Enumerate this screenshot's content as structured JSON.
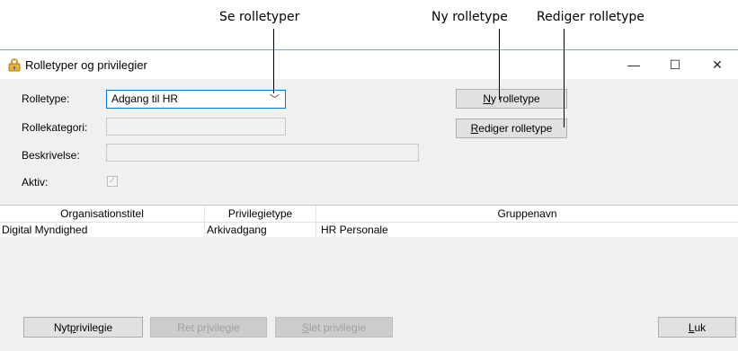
{
  "callouts": {
    "see_role_types": "Se rolletyper",
    "new_role_type": "Ny rolletype",
    "edit_role_type": "Rediger rolletype"
  },
  "window": {
    "title": "Rolletyper og privilegier",
    "title_icon": "key-lock-icon",
    "controls": {
      "minimize": "—",
      "maximize": "☐",
      "close": "✕"
    }
  },
  "form": {
    "role_type_label": "Rolletype:",
    "role_type_value": "Adgang til HR",
    "role_category_label": "Rollekategori:",
    "role_category_value": "",
    "description_label": "Beskrivelse:",
    "description_value": "",
    "active_label": "Aktiv:",
    "active_checked": true
  },
  "buttons": {
    "new_role_type": {
      "u": "N",
      "rest": "y rolletype"
    },
    "edit_role_type": {
      "u": "R",
      "rest": "ediger rolletype"
    },
    "new_privilege": {
      "pre": "Nyt ",
      "u": "p",
      "rest": "rivilegie"
    },
    "edit_privilege": {
      "pre": "Ret pr",
      "u": "i",
      "rest": "vilegie"
    },
    "delete_privilege": {
      "pre": "",
      "u": "S",
      "rest": "let privilegie"
    },
    "close": {
      "u": "L",
      "rest": "uk"
    }
  },
  "table": {
    "columns": [
      "Organisationstitel",
      "Privilegietype",
      "Gruppenavn"
    ],
    "rows": [
      [
        "Digital Myndighed",
        "Arkivadgang",
        "HR Personale"
      ]
    ]
  },
  "colors": {
    "accent": "#0078d7",
    "window_border": "#6aa9d8",
    "background": "#f0f0f0"
  }
}
